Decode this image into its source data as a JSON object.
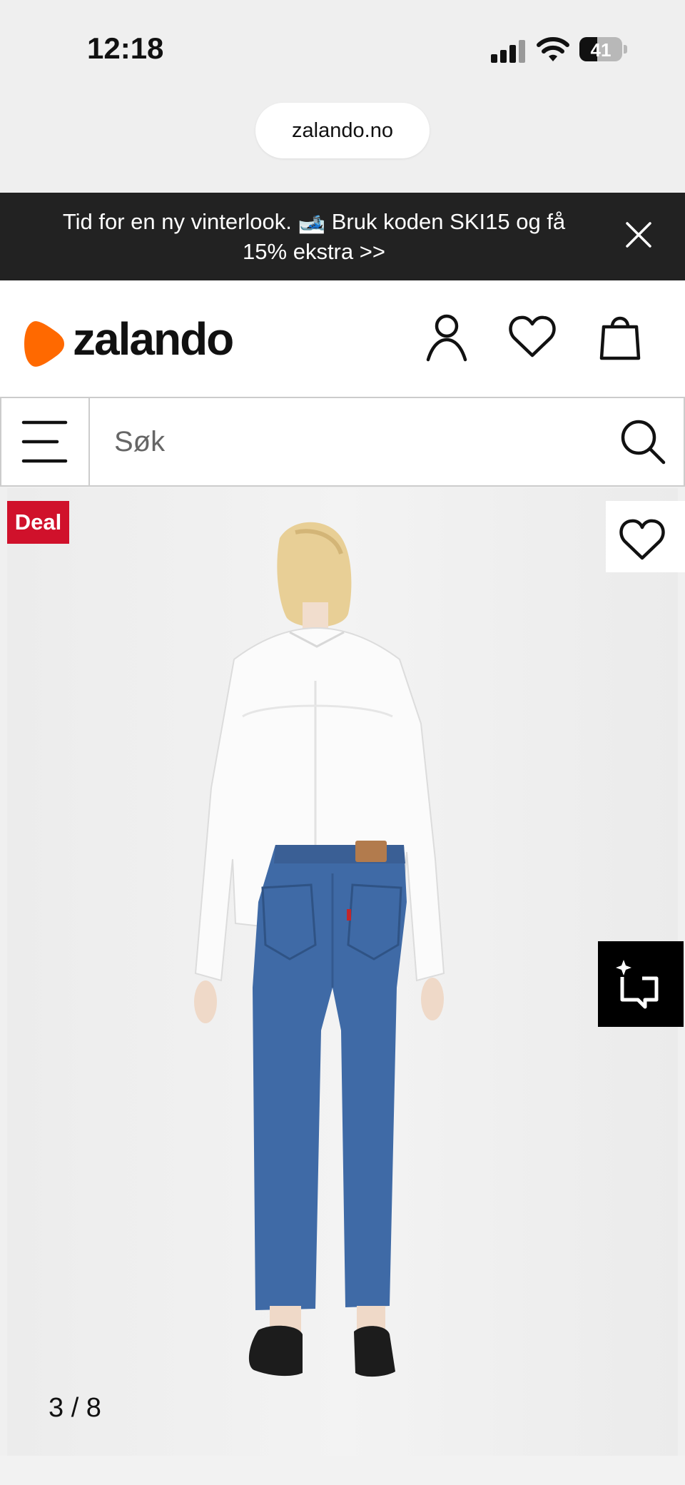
{
  "status_bar": {
    "time": "12:18",
    "battery": "41",
    "battery_level": 0.41,
    "icons": [
      "signal-icon",
      "wifi-icon",
      "battery-icon"
    ]
  },
  "browser": {
    "url": "zalando.no"
  },
  "promo": {
    "text": "Tid for en ny vinterlook. 🎿 Bruk koden SKI15 og få 15% ekstra >>",
    "close_icon": "close-icon"
  },
  "header": {
    "logo_text": "zalando",
    "brand_color": "#ff6900",
    "icons": [
      "account-icon",
      "wishlist-icon",
      "bag-icon"
    ]
  },
  "search": {
    "placeholder": "Søk",
    "menu_icon": "menu-icon",
    "search_icon": "search-icon"
  },
  "product": {
    "deal_badge": "Deal",
    "deal_color": "#d0112b",
    "image_counter": "3 / 8",
    "wishlist_icon": "heart-icon",
    "similar_icon": "find-similar-icon"
  }
}
